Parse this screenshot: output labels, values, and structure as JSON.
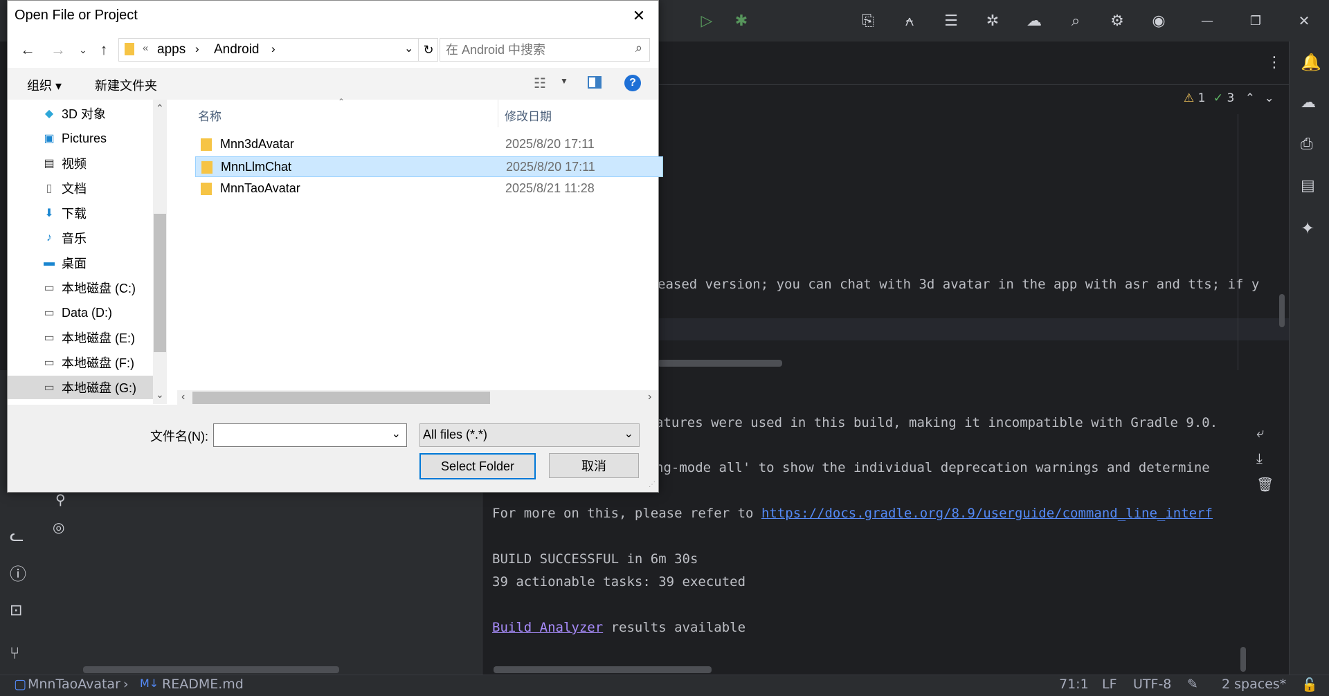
{
  "ide": {
    "editor_line_partial": "eased version; you can chat with 3d avatar in the app with asr and tts; if y",
    "inspections": {
      "warnings": "1",
      "ok": "3"
    },
    "console": {
      "line1": "atures were used in this build, making it incompatible with Gradle 9.0.",
      "line2": "ng-mode all' to show the individual deprecation warnings and determine",
      "line3_prefix": "For more on this, please refer to ",
      "line3_link": "https://docs.gradle.org/8.9/userguide/command_line_interf",
      "line4": "BUILD SUCCESSFUL in 6m 30s",
      "line5": "39 actionable tasks: 39 executed",
      "line6_link": "Build Analyzer",
      "line6_suffix": " results available"
    },
    "statusbar": {
      "project": "MnnTaoAvatar",
      "file": "README.md",
      "position": "71:1",
      "line_ending": "LF",
      "encoding": "UTF-8",
      "indent": "2 spaces*"
    }
  },
  "dialog": {
    "title": "Open File or Project",
    "breadcrumb": {
      "prefix": "«",
      "items": [
        "apps",
        "Android"
      ]
    },
    "search_placeholder": "在 Android 中搜索",
    "cmd": {
      "organize": "组织 ▾",
      "new_folder": "新建文件夹"
    },
    "nav_items": [
      {
        "label": "3D 对象",
        "icon": "cube-icon"
      },
      {
        "label": "Pictures",
        "icon": "picture-icon"
      },
      {
        "label": "视频",
        "icon": "video-icon"
      },
      {
        "label": "文档",
        "icon": "document-icon"
      },
      {
        "label": "下载",
        "icon": "download-icon"
      },
      {
        "label": "音乐",
        "icon": "music-icon"
      },
      {
        "label": "桌面",
        "icon": "desktop-icon"
      },
      {
        "label": "本地磁盘 (C:)",
        "icon": "drive-icon"
      },
      {
        "label": "Data (D:)",
        "icon": "drive-icon"
      },
      {
        "label": "本地磁盘 (E:)",
        "icon": "drive-icon"
      },
      {
        "label": "本地磁盘 (F:)",
        "icon": "drive-icon"
      },
      {
        "label": "本地磁盘 (G:)",
        "icon": "drive-icon"
      }
    ],
    "columns": {
      "name": "名称",
      "date": "修改日期"
    },
    "files": [
      {
        "name": "Mnn3dAvatar",
        "date": "2025/8/20 17:11"
      },
      {
        "name": "MnnLlmChat",
        "date": "2025/8/20 17:11"
      },
      {
        "name": "MnnTaoAvatar",
        "date": "2025/8/21 11:28"
      }
    ],
    "filename_label": "文件名(N):",
    "filename_value": "",
    "filetype_value": "All files (*.*)",
    "select_button": "Select Folder",
    "cancel_button": "取消"
  }
}
